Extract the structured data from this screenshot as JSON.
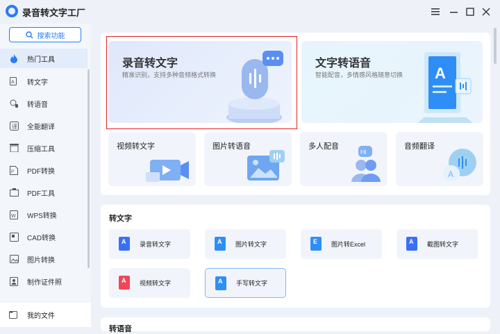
{
  "app": {
    "title": "录音转文字工厂"
  },
  "window": {
    "menu_icon": "menu-icon",
    "minimize_icon": "minimize-icon",
    "maximize_icon": "maximize-icon",
    "close_icon": "close-icon"
  },
  "sidebar": {
    "search_label": "搜索功能",
    "items": [
      {
        "label": "热门工具",
        "icon": "fire-icon",
        "active": true
      },
      {
        "label": "转文字",
        "icon": "text-convert-icon"
      },
      {
        "label": "转语音",
        "icon": "voice-icon"
      },
      {
        "label": "全能翻译",
        "icon": "translate-icon"
      },
      {
        "label": "压缩工具",
        "icon": "compress-icon"
      },
      {
        "label": "PDF转换",
        "icon": "pdf-convert-icon"
      },
      {
        "label": "PDF工具",
        "icon": "pdf-tool-icon"
      },
      {
        "label": "WPS转换",
        "icon": "wps-icon"
      },
      {
        "label": "CAD转换",
        "icon": "cad-icon"
      },
      {
        "label": "图片转换",
        "icon": "image-convert-icon"
      },
      {
        "label": "制作证件照",
        "icon": "id-photo-icon"
      }
    ],
    "my_files": "我的文件"
  },
  "hot": {
    "big": [
      {
        "title": "录音转文字",
        "subtitle": "精准识别，支持多种音频格式转换"
      },
      {
        "title": "文字转语音",
        "subtitle": "智能配音，多情感风格随意切换"
      }
    ],
    "small": [
      {
        "title": "视频转文字"
      },
      {
        "title": "图片转语音"
      },
      {
        "title": "多人配音"
      },
      {
        "title": "音频翻译"
      }
    ]
  },
  "section2": {
    "title": "转文字",
    "tools": [
      {
        "label": "录音转文字",
        "color": "#3a6ff7"
      },
      {
        "label": "图片转文字",
        "color": "#2f8ef5"
      },
      {
        "label": "图片转Excel",
        "color": "#2f8ef5"
      },
      {
        "label": "截图转文字",
        "color": "#3a6ff7"
      },
      {
        "label": "视频转文字",
        "color": "#f0465a"
      },
      {
        "label": "手写转文字",
        "color": "#2f8ef5"
      }
    ]
  },
  "section3": {
    "title": "转语音"
  },
  "colors": {
    "accent": "#2a7bf6",
    "highlight_border": "#e02020"
  }
}
